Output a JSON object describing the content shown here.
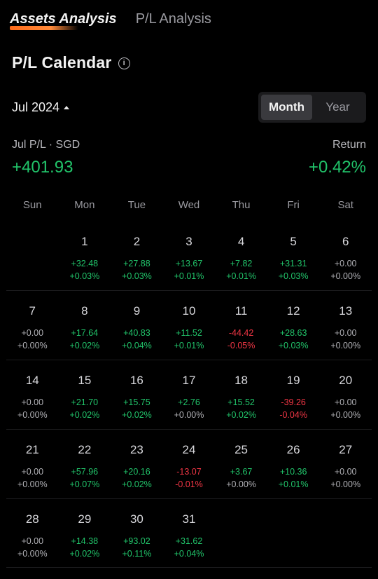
{
  "tabs": [
    {
      "label": "Assets Analysis",
      "active": true
    },
    {
      "label": "P/L Analysis",
      "active": false
    }
  ],
  "page_title": "P/L Calendar",
  "period": {
    "current": "Jul 2024",
    "options": [
      "Month",
      "Year"
    ],
    "selected": "Month"
  },
  "summary": {
    "pl_label": "Jul P/L · SGD",
    "pl_value": "+401.93",
    "return_label": "Return",
    "return_value": "+0.42%"
  },
  "weekdays": [
    "Sun",
    "Mon",
    "Tue",
    "Wed",
    "Thu",
    "Fri",
    "Sat"
  ],
  "leading_blank_days": 1,
  "days": [
    {
      "day": "1",
      "value": "+32.48",
      "pct": "+0.03%"
    },
    {
      "day": "2",
      "value": "+27.88",
      "pct": "+0.03%"
    },
    {
      "day": "3",
      "value": "+13.67",
      "pct": "+0.01%"
    },
    {
      "day": "4",
      "value": "+7.82",
      "pct": "+0.01%"
    },
    {
      "day": "5",
      "value": "+31.31",
      "pct": "+0.03%"
    },
    {
      "day": "6",
      "value": "+0.00",
      "pct": "+0.00%"
    },
    {
      "day": "7",
      "value": "+0.00",
      "pct": "+0.00%"
    },
    {
      "day": "8",
      "value": "+17.64",
      "pct": "+0.02%"
    },
    {
      "day": "9",
      "value": "+40.83",
      "pct": "+0.04%"
    },
    {
      "day": "10",
      "value": "+11.52",
      "pct": "+0.01%"
    },
    {
      "day": "11",
      "value": "-44.42",
      "pct": "-0.05%"
    },
    {
      "day": "12",
      "value": "+28.63",
      "pct": "+0.03%"
    },
    {
      "day": "13",
      "value": "+0.00",
      "pct": "+0.00%"
    },
    {
      "day": "14",
      "value": "+0.00",
      "pct": "+0.00%"
    },
    {
      "day": "15",
      "value": "+21.70",
      "pct": "+0.02%"
    },
    {
      "day": "16",
      "value": "+15.75",
      "pct": "+0.02%"
    },
    {
      "day": "17",
      "value": "+2.76",
      "pct": "+0.00%"
    },
    {
      "day": "18",
      "value": "+15.52",
      "pct": "+0.02%"
    },
    {
      "day": "19",
      "value": "-39.26",
      "pct": "-0.04%"
    },
    {
      "day": "20",
      "value": "+0.00",
      "pct": "+0.00%"
    },
    {
      "day": "21",
      "value": "+0.00",
      "pct": "+0.00%"
    },
    {
      "day": "22",
      "value": "+57.96",
      "pct": "+0.07%"
    },
    {
      "day": "23",
      "value": "+20.16",
      "pct": "+0.02%"
    },
    {
      "day": "24",
      "value": "-13.07",
      "pct": "-0.01%"
    },
    {
      "day": "25",
      "value": "+3.67",
      "pct": "+0.00%"
    },
    {
      "day": "26",
      "value": "+10.36",
      "pct": "+0.01%"
    },
    {
      "day": "27",
      "value": "+0.00",
      "pct": "+0.00%"
    },
    {
      "day": "28",
      "value": "+0.00",
      "pct": "+0.00%"
    },
    {
      "day": "29",
      "value": "+14.38",
      "pct": "+0.02%"
    },
    {
      "day": "30",
      "value": "+93.02",
      "pct": "+0.11%"
    },
    {
      "day": "31",
      "value": "+31.62",
      "pct": "+0.04%"
    }
  ],
  "colors": {
    "positive": "#21c46a",
    "negative": "#f23645",
    "neutral": "#b0b0b5",
    "accent": "#ff6b1a"
  },
  "icons": {
    "info": "info-icon",
    "caret": "caret-up-icon"
  }
}
